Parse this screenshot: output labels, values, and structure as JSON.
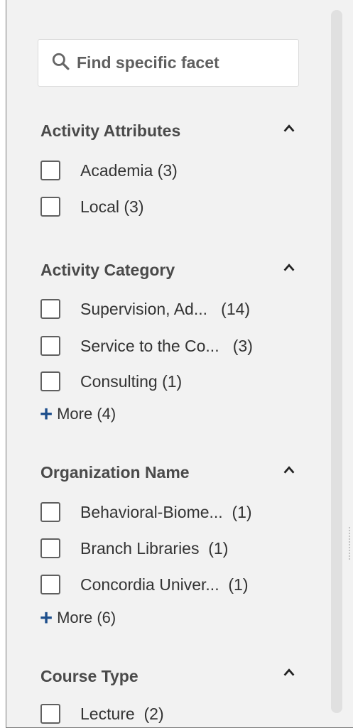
{
  "search": {
    "placeholder": "Find specific facet"
  },
  "facets": [
    {
      "title": "Activity Attributes",
      "items": [
        {
          "label": "Academia  (3)"
        },
        {
          "label": "Local  (3)"
        }
      ]
    },
    {
      "title": "Activity Category",
      "items": [
        {
          "label": "Supervision, Ad...   (14)"
        },
        {
          "label": "Service to the Co...   (3)"
        },
        {
          "label": "Consulting  (1)"
        }
      ],
      "more": "More (4)"
    },
    {
      "title": "Organization Name",
      "items": [
        {
          "label": "Behavioral-Biome...  (1)"
        },
        {
          "label": "Branch Libraries  (1)"
        },
        {
          "label": "Concordia Univer...  (1)"
        }
      ],
      "more": "More (6)"
    },
    {
      "title": "Course Type",
      "items": [
        {
          "label": "Lecture  (2)"
        }
      ]
    }
  ]
}
